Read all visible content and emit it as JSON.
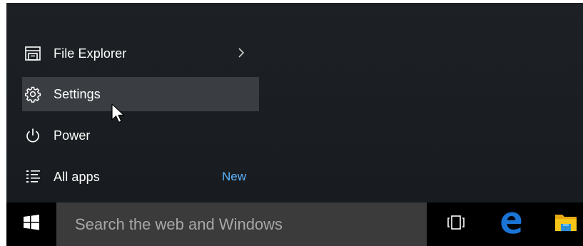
{
  "start_menu": {
    "items": [
      {
        "label": "File Explorer",
        "icon": "file-explorer-icon",
        "has_submenu": true
      },
      {
        "label": "Settings",
        "icon": "gear-icon",
        "selected": true
      },
      {
        "label": "Power",
        "icon": "power-icon"
      },
      {
        "label": "All apps",
        "icon": "all-apps-icon",
        "badge": "New"
      }
    ]
  },
  "taskbar": {
    "search_placeholder": "Search the web and Windows",
    "icons": [
      "windows-logo-icon",
      "task-view-icon",
      "edge-icon",
      "file-explorer-icon"
    ]
  },
  "colors": {
    "menu_background": "#1d2125",
    "selected_background": "#3a3e42",
    "badge_color": "#5cb4ff",
    "taskbar_background": "#000000",
    "search_background": "#3b3b3b",
    "edge_blue": "#1a74d6",
    "folder_yellow": "#f5c518"
  }
}
